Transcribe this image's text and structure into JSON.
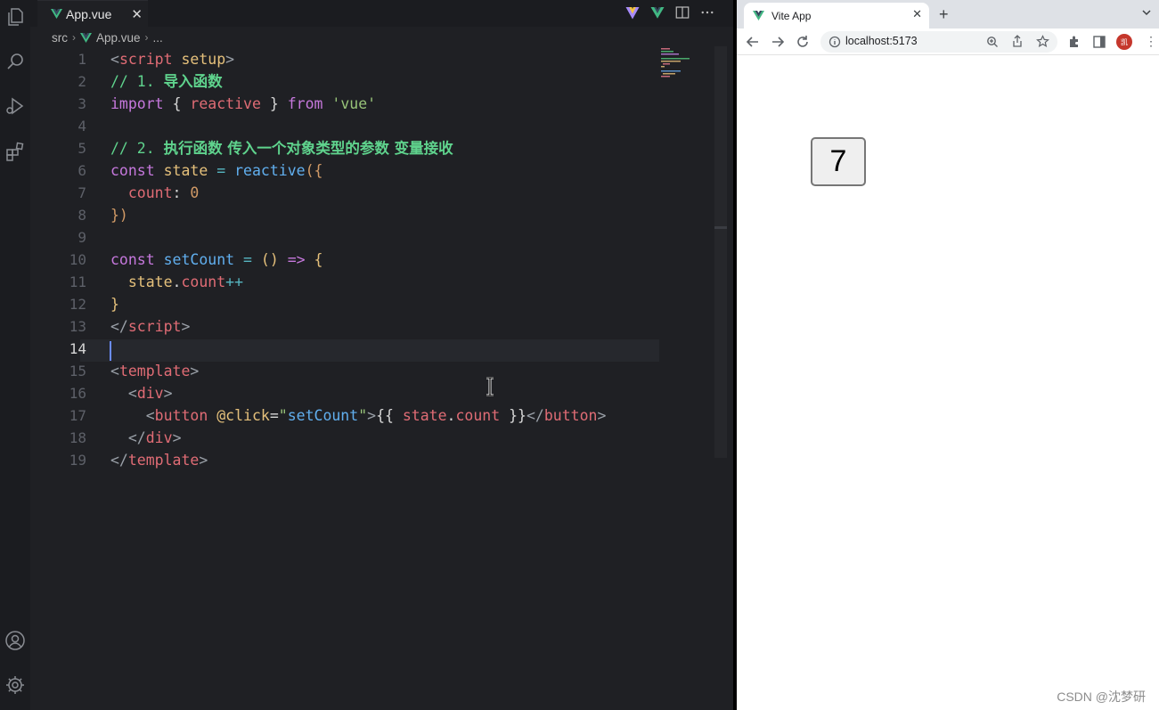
{
  "editor": {
    "tab": {
      "label": "App.vue",
      "close": "✕"
    },
    "breadcrumb": {
      "folder": "src",
      "file": "App.vue",
      "more": "..."
    },
    "current_line": 14,
    "lines": [
      {
        "n": "1",
        "tokens": [
          [
            "<",
            "#9aa0a8"
          ],
          [
            "script",
            "#e06c75"
          ],
          [
            " setup",
            "#e5c07b"
          ],
          [
            ">",
            "#9aa0a8"
          ]
        ]
      },
      {
        "n": "2",
        "tokens": [
          [
            "// 1. ",
            "#5fd38d"
          ],
          [
            "导入函数",
            "#5fd38d",
            "b"
          ]
        ]
      },
      {
        "n": "3",
        "tokens": [
          [
            "import",
            "#c678dd"
          ],
          [
            " { ",
            "#d7d7d7"
          ],
          [
            "reactive",
            "#e06c75"
          ],
          [
            " } ",
            "#d7d7d7"
          ],
          [
            "from",
            "#c678dd"
          ],
          [
            " 'vue'",
            "#98c379"
          ]
        ]
      },
      {
        "n": "4",
        "tokens": []
      },
      {
        "n": "5",
        "tokens": [
          [
            "// 2. ",
            "#5fd38d"
          ],
          [
            "执行函数 传入一个对象类型的参数 变量接收",
            "#5fd38d",
            "b"
          ]
        ]
      },
      {
        "n": "6",
        "tokens": [
          [
            "const",
            "#c678dd"
          ],
          [
            " state",
            "#e5c07b"
          ],
          [
            " = ",
            "#56b6c2"
          ],
          [
            "reactive",
            "#61afef"
          ],
          [
            "({",
            "#d19a66"
          ]
        ]
      },
      {
        "n": "7",
        "tokens": [
          [
            "  count",
            "#e06c75"
          ],
          [
            ": ",
            "#d7d7d7"
          ],
          [
            "0",
            "#d19a66"
          ]
        ]
      },
      {
        "n": "8",
        "tokens": [
          [
            "})",
            "#d19a66"
          ]
        ]
      },
      {
        "n": "9",
        "tokens": []
      },
      {
        "n": "10",
        "tokens": [
          [
            "const",
            "#c678dd"
          ],
          [
            " setCount",
            "#61afef"
          ],
          [
            " = ",
            "#56b6c2"
          ],
          [
            "()",
            "#e5c07b"
          ],
          [
            " => ",
            "#c678dd"
          ],
          [
            "{",
            "#e5c07b"
          ]
        ]
      },
      {
        "n": "11",
        "tokens": [
          [
            "  state",
            "#e5c07b"
          ],
          [
            ".",
            "#d7d7d7"
          ],
          [
            "count",
            "#e06c75"
          ],
          [
            "++",
            "#56b6c2"
          ]
        ]
      },
      {
        "n": "12",
        "tokens": [
          [
            "}",
            "#e5c07b"
          ]
        ]
      },
      {
        "n": "13",
        "tokens": [
          [
            "</",
            "#9aa0a8"
          ],
          [
            "script",
            "#e06c75"
          ],
          [
            ">",
            "#9aa0a8"
          ]
        ]
      },
      {
        "n": "14",
        "tokens": []
      },
      {
        "n": "15",
        "tokens": [
          [
            "<",
            "#9aa0a8"
          ],
          [
            "template",
            "#e06c75"
          ],
          [
            ">",
            "#9aa0a8"
          ]
        ]
      },
      {
        "n": "16",
        "tokens": [
          [
            "  <",
            "#9aa0a8"
          ],
          [
            "div",
            "#e06c75"
          ],
          [
            ">",
            "#9aa0a8"
          ]
        ]
      },
      {
        "n": "17",
        "tokens": [
          [
            "    <",
            "#9aa0a8"
          ],
          [
            "button",
            "#e06c75"
          ],
          [
            " @click",
            "#e5c07b"
          ],
          [
            "=",
            "#d7d7d7"
          ],
          [
            "\"",
            "#98c379"
          ],
          [
            "setCount",
            "#61afef"
          ],
          [
            "\"",
            "#98c379"
          ],
          [
            ">",
            "#9aa0a8"
          ],
          [
            "{{ ",
            "#d7d7d7"
          ],
          [
            "state",
            "#e06c75"
          ],
          [
            ".",
            "#d7d7d7"
          ],
          [
            "count",
            "#e06c75"
          ],
          [
            " }}",
            "#d7d7d7"
          ],
          [
            "</",
            "#9aa0a8"
          ],
          [
            "button",
            "#e06c75"
          ],
          [
            ">",
            "#9aa0a8"
          ]
        ]
      },
      {
        "n": "18",
        "tokens": [
          [
            "  </",
            "#9aa0a8"
          ],
          [
            "div",
            "#e06c75"
          ],
          [
            ">",
            "#9aa0a8"
          ]
        ]
      },
      {
        "n": "19",
        "tokens": [
          [
            "</",
            "#9aa0a8"
          ],
          [
            "template",
            "#e06c75"
          ],
          [
            ">",
            "#9aa0a8"
          ]
        ]
      }
    ]
  },
  "browser": {
    "tab_title": "Vite App",
    "tab_close": "✕",
    "new_tab": "+",
    "url": "localhost:5173",
    "profile_initial": "凯",
    "menu": "⋮",
    "button_value": "7"
  },
  "watermark": "CSDN @沈梦研",
  "colors": {
    "vue_green": "#41b883",
    "vue_dark": "#35495e",
    "accent_caret": "#6a8cff"
  }
}
